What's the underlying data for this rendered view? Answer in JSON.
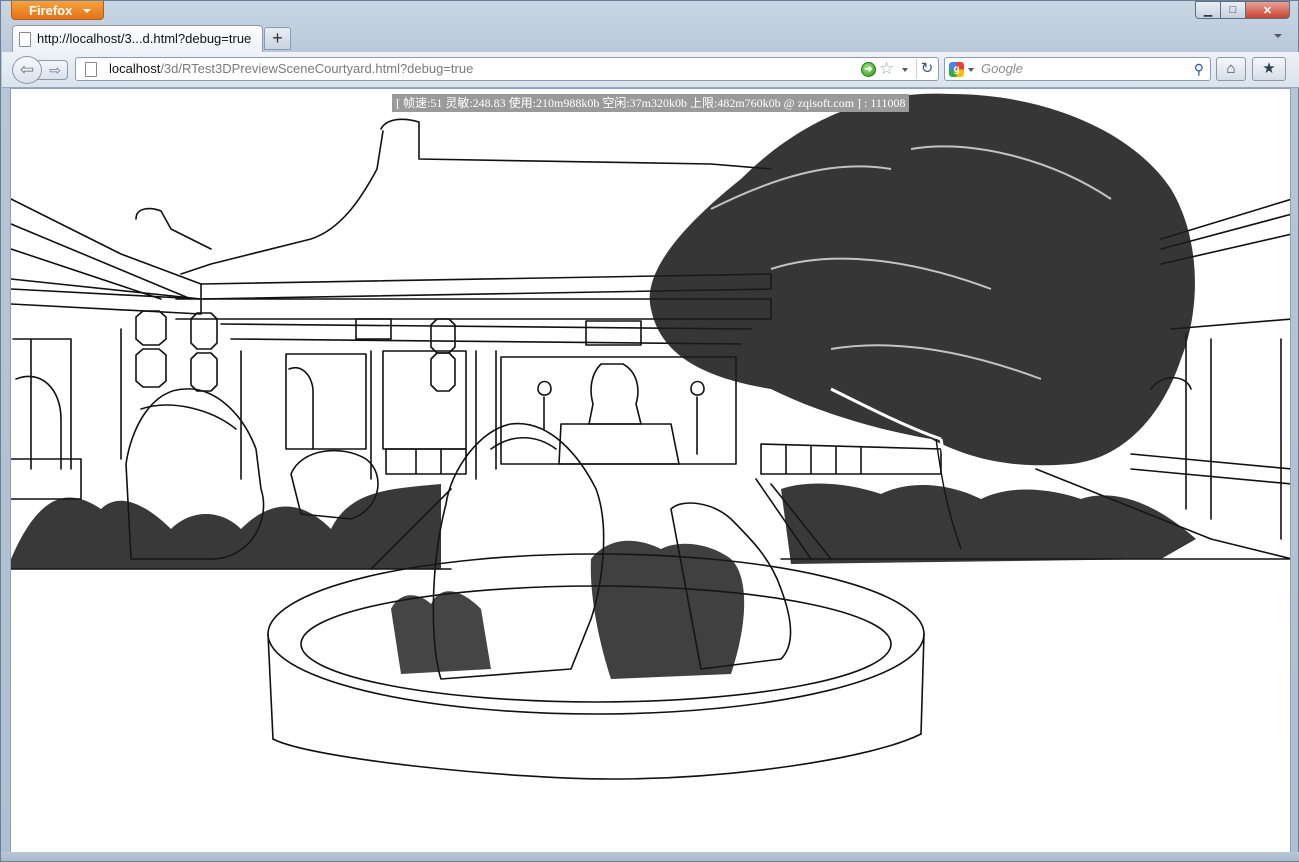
{
  "window": {
    "app_button_label": "Firefox",
    "minimize_glyph": "▁",
    "maximize_glyph": "□",
    "close_glyph": "✕"
  },
  "tabs": [
    {
      "label": "http://localhost/3...d.html?debug=true",
      "active": true
    }
  ],
  "new_tab_glyph": "+",
  "navigation": {
    "back_glyph": "⇦",
    "forward_glyph": "⇨",
    "url_host": "localhost",
    "url_path": "/3d/RTest3DPreviewSceneCourtyard.html?debug=true",
    "go_glyph": "➜",
    "bookmark_glyph": "☆",
    "reload_glyph": "↻",
    "search_placeholder": "Google",
    "search_engine_glyph": "g",
    "search_go_glyph": "⚲",
    "home_glyph": "⌂",
    "bookmarks_glyph": "★"
  },
  "debug_overlay": "[ 帧速:51 灵敏:248.83 使用:210m988k0b 空闲:37m320k0b 上限:482m760k0b @ zqisoft.com ] : 111008",
  "icons": {
    "tab_page": "page-icon",
    "url_page": "page-icon",
    "go": "go-arrow-icon",
    "star": "star-icon",
    "reload": "reload-icon",
    "search": "magnifier-icon",
    "home": "home-icon",
    "bookmarks": "bookmarks-icon"
  },
  "colors": {
    "firefox_orange": "#e2731b",
    "debug_overlay_bg": "#9a9a9a",
    "go_green": "#2d9a1f"
  }
}
